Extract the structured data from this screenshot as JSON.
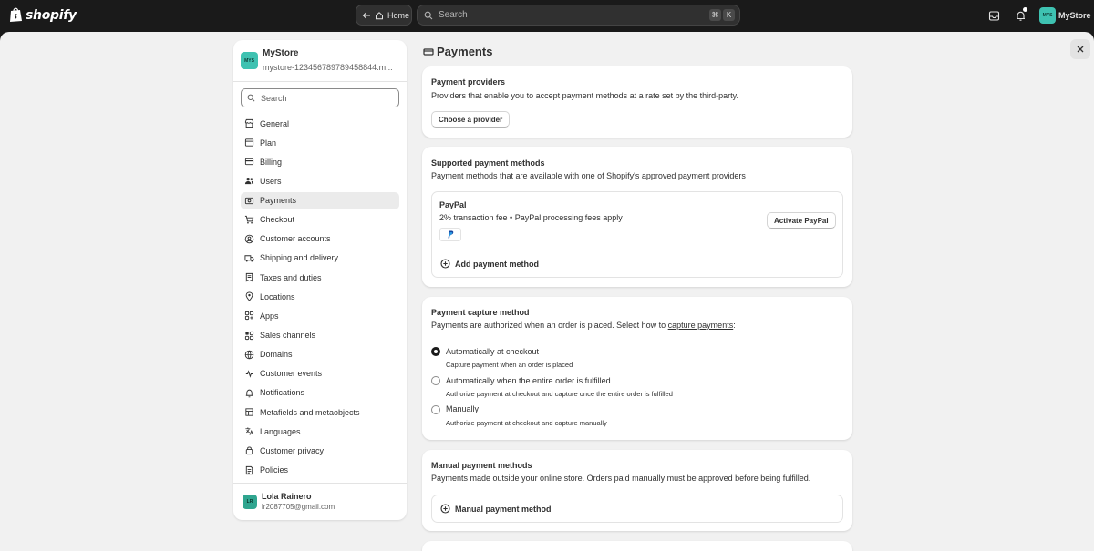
{
  "topbar": {
    "logo_text": "shopify",
    "home_label": "Home",
    "search_placeholder": "Search",
    "shortcut_key1": "⌘",
    "shortcut_key2": "K",
    "store_initials": "MYS",
    "store_name": "MyStore"
  },
  "sidebar": {
    "store_initials": "MYS",
    "store_name": "MyStore",
    "store_domain": "mystore-123456789789458844.m...",
    "search_placeholder": "Search",
    "items": [
      {
        "label": "General",
        "icon": "store-icon",
        "active": false
      },
      {
        "label": "Plan",
        "icon": "plan-icon",
        "active": false
      },
      {
        "label": "Billing",
        "icon": "billing-icon",
        "active": false
      },
      {
        "label": "Users",
        "icon": "users-icon",
        "active": false
      },
      {
        "label": "Payments",
        "icon": "payments-icon",
        "active": true
      },
      {
        "label": "Checkout",
        "icon": "cart-icon",
        "active": false
      },
      {
        "label": "Customer accounts",
        "icon": "person-icon",
        "active": false
      },
      {
        "label": "Shipping and delivery",
        "icon": "truck-icon",
        "active": false
      },
      {
        "label": "Taxes and duties",
        "icon": "receipt-icon",
        "active": false
      },
      {
        "label": "Locations",
        "icon": "location-icon",
        "active": false
      },
      {
        "label": "Apps",
        "icon": "apps-icon",
        "active": false
      },
      {
        "label": "Sales channels",
        "icon": "channels-icon",
        "active": false
      },
      {
        "label": "Domains",
        "icon": "globe-icon",
        "active": false
      },
      {
        "label": "Customer events",
        "icon": "events-icon",
        "active": false
      },
      {
        "label": "Notifications",
        "icon": "bell-icon",
        "active": false
      },
      {
        "label": "Metafields and metaobjects",
        "icon": "metafields-icon",
        "active": false
      },
      {
        "label": "Languages",
        "icon": "language-icon",
        "active": false
      },
      {
        "label": "Customer privacy",
        "icon": "lock-icon",
        "active": false
      },
      {
        "label": "Policies",
        "icon": "policies-icon",
        "active": false
      }
    ],
    "user": {
      "initials": "LR",
      "name": "Lola Rainero",
      "email": "lr2087705@gmail.com"
    }
  },
  "page": {
    "title": "Payments"
  },
  "providers_card": {
    "title": "Payment providers",
    "subtitle": "Providers that enable you to accept payment methods at a rate set by the third-party.",
    "button": "Choose a provider"
  },
  "supported_card": {
    "title": "Supported payment methods",
    "subtitle": "Payment methods that are available with one of Shopify's approved payment providers",
    "paypal_name": "PayPal",
    "paypal_fees": "2% transaction fee • PayPal processing fees apply",
    "activate_button": "Activate PayPal",
    "add_label": "Add payment method"
  },
  "capture_card": {
    "title": "Payment capture method",
    "subtitle_prefix": "Payments are authorized when an order is placed. Select how to ",
    "subtitle_link": "capture payments",
    "subtitle_suffix": ":",
    "options": [
      {
        "label": "Automatically at checkout",
        "help": "Capture payment when an order is placed",
        "checked": true
      },
      {
        "label": "Automatically when the entire order is fulfilled",
        "help": "Authorize payment at checkout and capture once the entire order is fulfilled",
        "checked": false
      },
      {
        "label": "Manually",
        "help": "Authorize payment at checkout and capture manually",
        "checked": false
      }
    ]
  },
  "manual_card": {
    "title": "Manual payment methods",
    "subtitle": "Payments made outside your online store. Orders paid manually must be approved before being fulfilled.",
    "add_label": "Manual payment method"
  }
}
